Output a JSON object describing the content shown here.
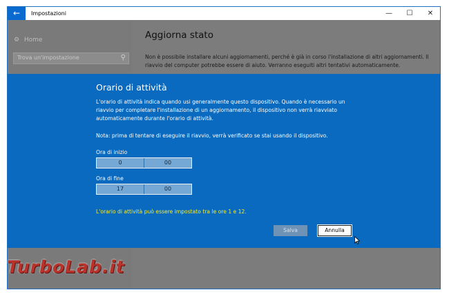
{
  "window": {
    "title": "Impostazioni",
    "back_glyph": "←",
    "minimize_glyph": "—",
    "maximize_glyph": "☐",
    "close_glyph": "✕"
  },
  "sidebar": {
    "home_label": "Home",
    "home_icon": "gear-icon",
    "search_placeholder": "Trova un'impostazione",
    "search_icon": "search-icon"
  },
  "main": {
    "heading": "Aggiorna stato",
    "body": "Non è possibile installare alcuni aggiornamenti, perché è già in corso l'installazione di altri aggiornamenti. Il riavvio del computer potrebbe essere di aiuto. Verranno eseguiti altri tentativi automaticamente."
  },
  "dialog": {
    "title": "Orario di attività",
    "description": "L'orario di attività indica quando usi generalmente questo dispositivo. Quando è necessario un riavvio per completare l'installazione di un aggiornamento, il dispositivo non verrà riavviato automaticamente durante l'orario di attività.",
    "note": "Nota: prima di tentare di eseguire il riavvio, verrà verificato se stai usando il dispositivo.",
    "start": {
      "label": "Ora di inizio",
      "hour": "0",
      "minute": "00"
    },
    "end": {
      "label": "Ora di fine",
      "hour": "17",
      "minute": "00"
    },
    "warning": "L'orario di attività può essere impostato tra le ore 1 e 12.",
    "save_label": "Salva",
    "cancel_label": "Annulla"
  },
  "colors": {
    "accent": "#0a6ad0",
    "dialog_bg": "#0a6ac0",
    "warning_text": "#f8ec2d",
    "overlay_gray": "#7c7c7c"
  },
  "watermark": {
    "text": "TurboLab.it"
  }
}
